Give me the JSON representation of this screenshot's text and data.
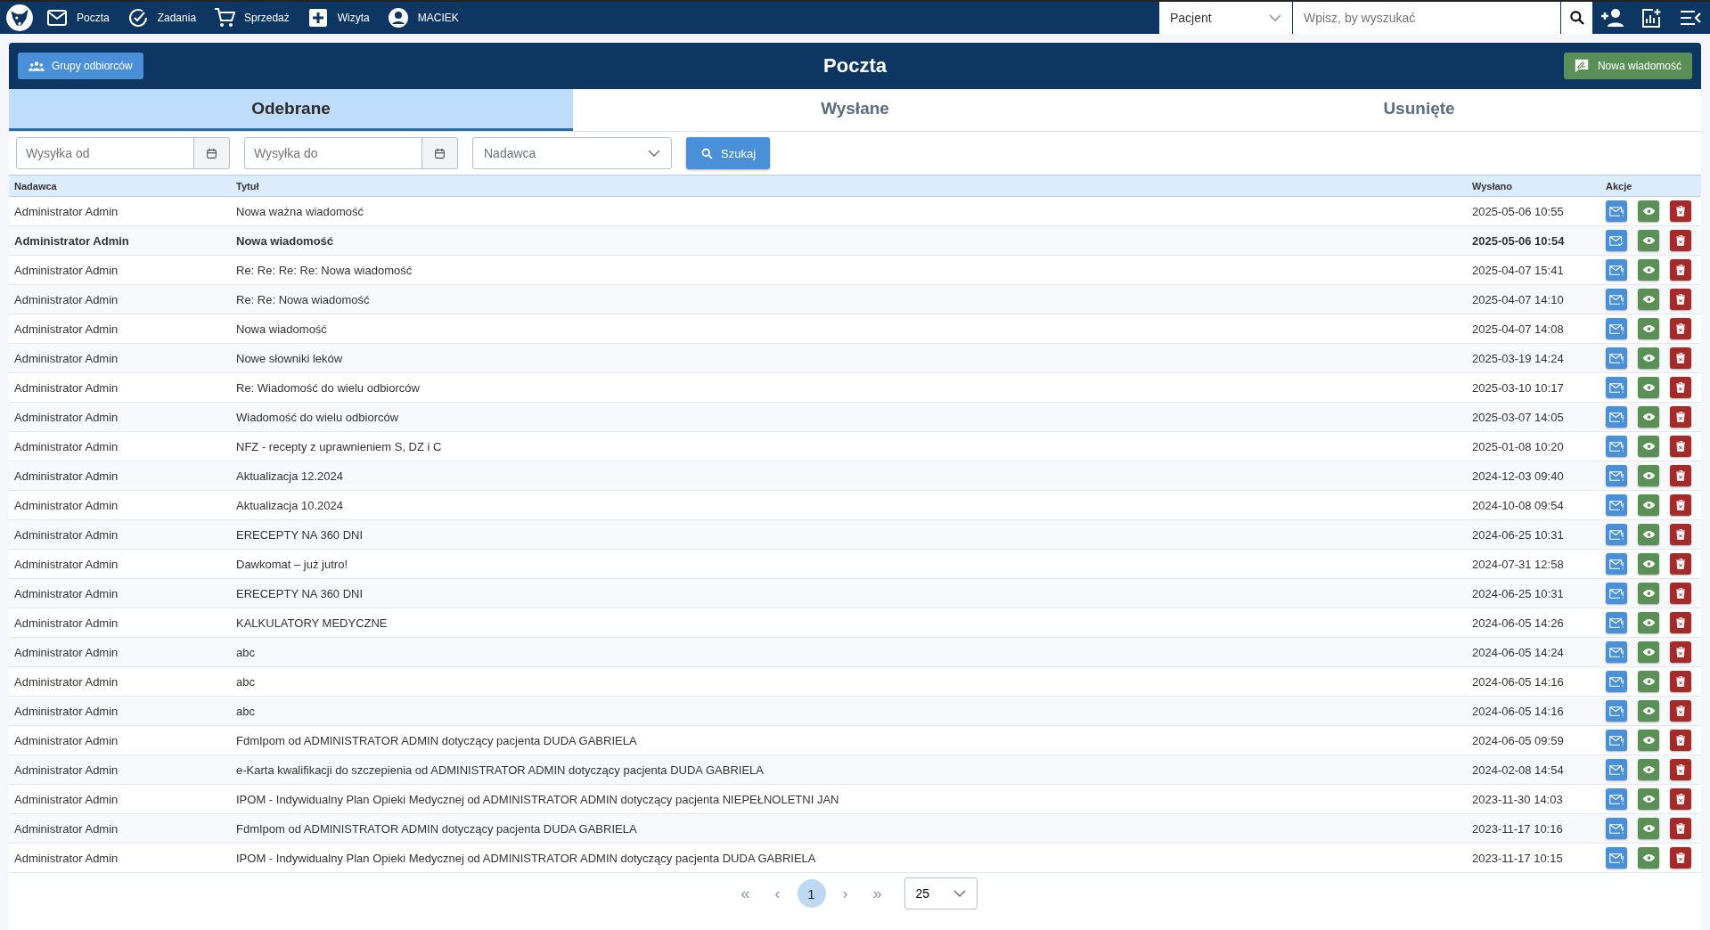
{
  "topbar": {
    "nav": [
      {
        "kind": "mail",
        "label": "Poczta"
      },
      {
        "kind": "check",
        "label": "Zadania"
      },
      {
        "kind": "cart",
        "label": "Sprzedaż"
      },
      {
        "kind": "plus",
        "label": "Wizyta"
      },
      {
        "kind": "user",
        "label": "MACIEK"
      }
    ],
    "search_scope": "Pacjent",
    "search": {
      "placeholder": "Wpisz, by wyszukać"
    }
  },
  "header": {
    "title": "Poczta",
    "groups_button": "Grupy odbiorców",
    "new_button": "Nowa wiadomość"
  },
  "tabs": [
    {
      "label": "Odebrane",
      "selected": true
    },
    {
      "label": "Wysłane",
      "selected": false
    },
    {
      "label": "Usunięte",
      "selected": false
    }
  ],
  "filters": {
    "date_from": {
      "placeholder": "Wysyłka od"
    },
    "date_to": {
      "placeholder": "Wysyłka do"
    },
    "sender": {
      "placeholder": "Nadawca"
    },
    "search_button": "Szukaj"
  },
  "table": {
    "columns": [
      "Nadawca",
      "Tytuł",
      "Wysłano",
      "Akcje"
    ],
    "rows": [
      {
        "sender": "Administrator Admin",
        "title": "Nowa ważna wiadomość",
        "sent": "2025-05-06 10:55",
        "unread": false
      },
      {
        "sender": "Administrator Admin",
        "title": "Nowa wiadomość",
        "sent": "2025-05-06 10:54",
        "unread": true
      },
      {
        "sender": "Administrator Admin",
        "title": "Re: Re: Re: Re: Nowa wiadomość",
        "sent": "2025-04-07 15:41",
        "unread": false
      },
      {
        "sender": "Administrator Admin",
        "title": "Re: Re: Nowa wiadomość",
        "sent": "2025-04-07 14:10",
        "unread": false
      },
      {
        "sender": "Administrator Admin",
        "title": "Nowa wiadomość",
        "sent": "2025-04-07 14:08",
        "unread": false
      },
      {
        "sender": "Administrator Admin",
        "title": "Nowe słowniki leków",
        "sent": "2025-03-19 14:24",
        "unread": false
      },
      {
        "sender": "Administrator Admin",
        "title": "Re: Wiadomość do wielu odbiorców",
        "sent": "2025-03-10 10:17",
        "unread": false
      },
      {
        "sender": "Administrator Admin",
        "title": "Wiadomość do wielu odbiorców",
        "sent": "2025-03-07 14:05",
        "unread": false
      },
      {
        "sender": "Administrator Admin",
        "title": "NFZ - recepty z uprawnieniem S, DZ i C",
        "sent": "2025-01-08 10:20",
        "unread": false
      },
      {
        "sender": "Administrator Admin",
        "title": "Aktualizacja 12.2024",
        "sent": "2024-12-03 09:40",
        "unread": false
      },
      {
        "sender": "Administrator Admin",
        "title": "Aktualizacja 10.2024",
        "sent": "2024-10-08 09:54",
        "unread": false
      },
      {
        "sender": "Administrator Admin",
        "title": "ERECEPTY NA 360 DNI",
        "sent": "2024-06-25 10:31",
        "unread": false
      },
      {
        "sender": "Administrator Admin",
        "title": "Dawkomat – już jutro!",
        "sent": "2024-07-31 12:58",
        "unread": false
      },
      {
        "sender": "Administrator Admin",
        "title": "ERECEPTY NA 360 DNI",
        "sent": "2024-06-25 10:31",
        "unread": false
      },
      {
        "sender": "Administrator Admin",
        "title": "KALKULATORY MEDYCZNE",
        "sent": "2024-06-05 14:26",
        "unread": false
      },
      {
        "sender": "Administrator Admin",
        "title": "abc",
        "sent": "2024-06-05 14:24",
        "unread": false
      },
      {
        "sender": "Administrator Admin",
        "title": "abc",
        "sent": "2024-06-05 14:16",
        "unread": false
      },
      {
        "sender": "Administrator Admin",
        "title": "abc",
        "sent": "2024-06-05 14:16",
        "unread": false
      },
      {
        "sender": "Administrator Admin",
        "title": "FdmIpom od ADMINISTRATOR ADMIN dotyczący pacjenta DUDA GABRIELA",
        "sent": "2024-06-05 09:59",
        "unread": false
      },
      {
        "sender": "Administrator Admin",
        "title": "e-Karta kwalifikacji do szczepienia od ADMINISTRATOR ADMIN dotyczący pacjenta DUDA GABRIELA",
        "sent": "2024-02-08 14:54",
        "unread": false
      },
      {
        "sender": "Administrator Admin",
        "title": "IPOM - Indywidualny Plan Opieki Medycznej od ADMINISTRATOR ADMIN dotyczący pacjenta NIEPEŁNOLETNI JAN",
        "sent": "2023-11-30 14:03",
        "unread": false
      },
      {
        "sender": "Administrator Admin",
        "title": "FdmIpom od ADMINISTRATOR ADMIN dotyczący pacjenta DUDA GABRIELA",
        "sent": "2023-11-17 10:16",
        "unread": false
      },
      {
        "sender": "Administrator Admin",
        "title": "IPOM - Indywidualny Plan Opieki Medycznej od ADMINISTRATOR ADMIN dotyczący pacjenta DUDA GABRIELA",
        "sent": "2023-11-17 10:15",
        "unread": false
      }
    ]
  },
  "pagination": {
    "first": "«",
    "prev": "‹",
    "pages": [
      {
        "label": "1",
        "selected": true
      }
    ],
    "next": "›",
    "last": "»",
    "page_size": "25"
  }
}
